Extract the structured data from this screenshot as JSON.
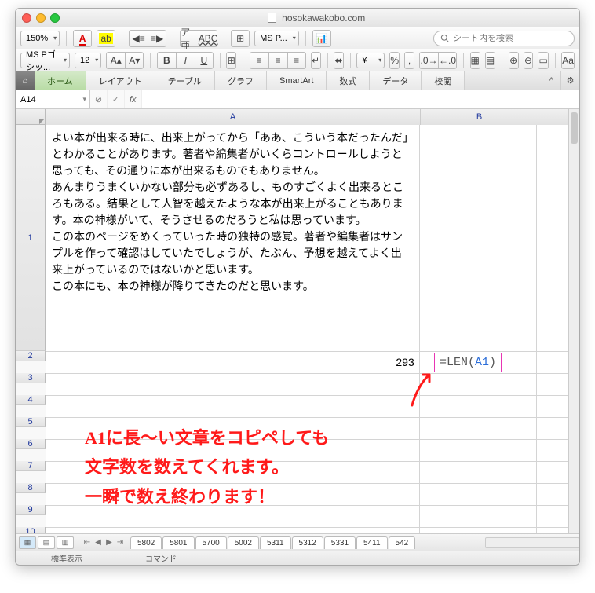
{
  "window": {
    "title": "hosokawakobo.com"
  },
  "toolbar1": {
    "zoom": "150%",
    "font_color_btn": "A",
    "msp_label": "MS P...",
    "search": {
      "placeholder": "シート内を検索"
    }
  },
  "toolbar2": {
    "font_name": "MS Pゴシッ...",
    "font_size": "12"
  },
  "ribbon": {
    "tabs": [
      "ホーム",
      "レイアウト",
      "テーブル",
      "グラフ",
      "SmartArt",
      "数式",
      "データ",
      "校閲"
    ],
    "active_index": 0
  },
  "namebox": {
    "value": "A14"
  },
  "fx": {
    "label": "fx"
  },
  "columns": [
    "A",
    "B"
  ],
  "cell_a1": "よい本が出来る時に、出来上がってから「ああ、こういう本だったんだ」とわかることがあります。著者や編集者がいくらコントロールしようと思っても、その通りに本が出来るものでもありません。\nあんまりうまくいかない部分も必ずあるし、ものすごくよく出来るところもある。結果として人智を越えたような本が出来上がることもあります。本の神様がいて、そうさせるのだろうと私は思っています。\nこの本のページをめくっていった時の独特の感覚。著者や編集者はサンプルを作って確認はしていたでしょうが、たぶん、予想を越えてよく出来上がっているのではないかと思います。\nこの本にも、本の神様が降りてきたのだと思います。",
  "cell_a2": "293",
  "formula": {
    "text": "=LEN(",
    "ref": "A1",
    "close": ")"
  },
  "annotation": {
    "line1": "A1に長〜い文章をコピペしても",
    "line2": "文字数を数えてくれます。",
    "line3": "一瞬で数え終わります！"
  },
  "sheet_tabs": [
    "5802",
    "5801",
    "5700",
    "5002",
    "5311",
    "5312",
    "5331",
    "5411",
    "542"
  ],
  "status": {
    "mode": "標準表示",
    "cmd": "コマンド"
  }
}
